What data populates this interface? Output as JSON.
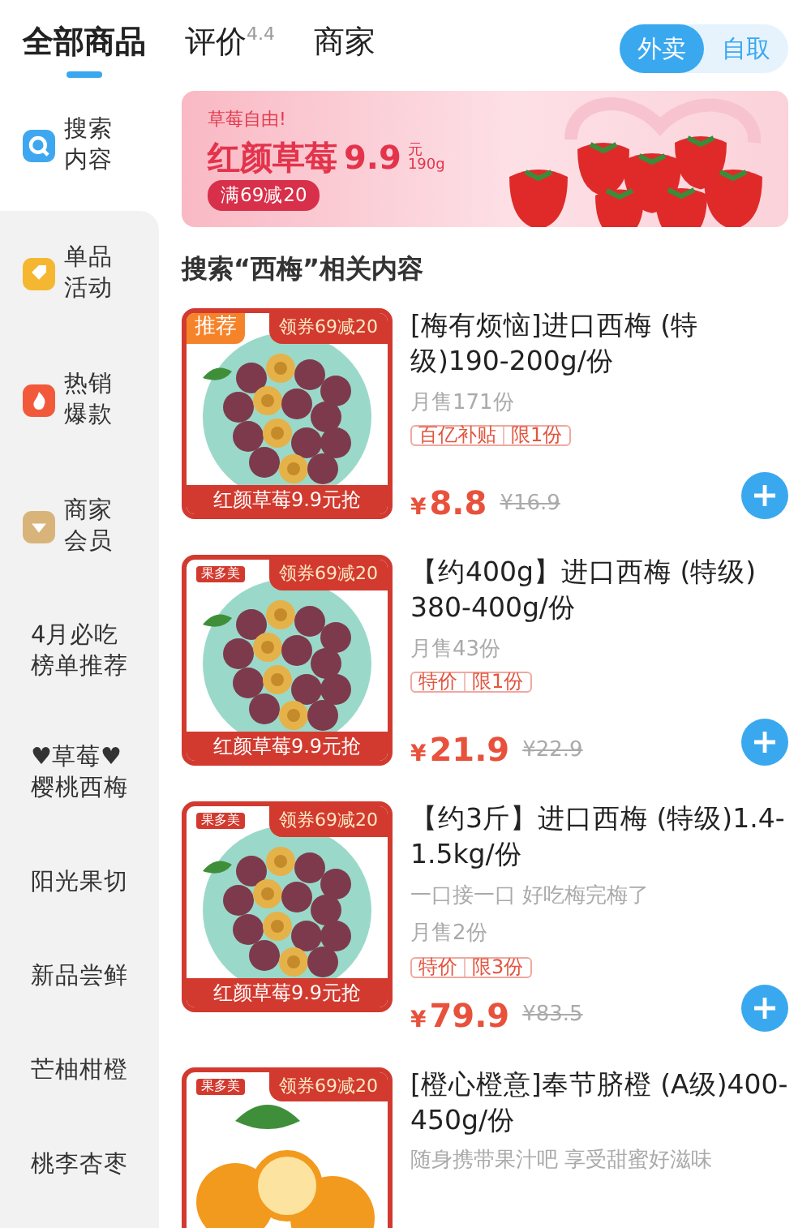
{
  "tabs": [
    {
      "label": "全部商品",
      "selected": true
    },
    {
      "label": "评价",
      "sup": "4.4",
      "selected": false
    },
    {
      "label": "商家",
      "selected": false
    }
  ],
  "mode_toggle": [
    {
      "label": "外卖",
      "selected": true
    },
    {
      "label": "自取",
      "selected": false
    }
  ],
  "banner": {
    "kicker": "草莓自由!",
    "headline": "红颜草莓",
    "price": "9.9",
    "unit_top": "元",
    "unit_bottom": "190g",
    "coupon": "满69减20"
  },
  "sidebar": {
    "items": [
      {
        "label": "搜索内容",
        "kind": "search",
        "color": "#3fa7f0",
        "selected": true
      },
      {
        "label": "单品活动",
        "kind": "tag",
        "color": "#f5b731",
        "selected": false
      },
      {
        "label": "热销爆款",
        "kind": "flame",
        "color": "#f2593b",
        "selected": false
      },
      {
        "label": "商家会员",
        "kind": "gem",
        "color": "#d9b47a",
        "selected": false
      },
      {
        "label": "4月必吃榜单推荐",
        "kind": "text",
        "selected": false
      },
      {
        "label": "♥草莓♥樱桃西梅",
        "kind": "text",
        "selected": false
      },
      {
        "label": "阳光果切",
        "kind": "text",
        "selected": false
      },
      {
        "label": "新品尝鲜",
        "kind": "text",
        "selected": false
      },
      {
        "label": "芒柚柑橙",
        "kind": "text",
        "selected": false
      },
      {
        "label": "桃李杏枣",
        "kind": "text",
        "selected": false
      }
    ]
  },
  "section_title": "搜索“西梅”相关内容",
  "products": [
    {
      "title": "[梅有烦恼]进口西梅 (特级)190-200g/份",
      "sales": "月售171份",
      "tags": [
        "百亿补贴",
        "限1份"
      ],
      "currency": "¥",
      "price": "8.8",
      "original_price": "¥16.9",
      "image": {
        "kind": "plum",
        "badge": {
          "text": "推荐",
          "kind": "recommend"
        },
        "coupon": "领券69减20",
        "strip": "红颜草莓9.9元抢"
      }
    },
    {
      "title": "【约400g】进口西梅 (特级) 380-400g/份",
      "sales": "月售43份",
      "tags": [
        "特价",
        "限1份"
      ],
      "currency": "¥",
      "price": "21.9",
      "original_price": "¥22.9",
      "image": {
        "kind": "plum",
        "badge": {
          "text": "果多美",
          "kind": "shop"
        },
        "coupon": "领券69减20",
        "strip": "红颜草莓9.9元抢"
      }
    },
    {
      "title": "【约3斤】进口西梅 (特级)1.4-1.5kg/份",
      "tagline": "一口接一口 好吃梅完梅了",
      "sales": "月售2份",
      "tags": [
        "特价",
        "限3份"
      ],
      "currency": "¥",
      "price": "79.9",
      "original_price": "¥83.5",
      "image": {
        "kind": "plum",
        "badge": {
          "text": "果多美",
          "kind": "shop"
        },
        "coupon": "领券69减20",
        "strip": "红颜草莓9.9元抢"
      }
    },
    {
      "title": "[橙心橙意]奉节脐橙 (A级)400-450g/份",
      "tagline": "随身携带果汁吧 享受甜蜜好滋味",
      "image": {
        "kind": "orange",
        "badge": {
          "text": "果多美",
          "kind": "shop"
        },
        "coupon": "领券69减20"
      }
    }
  ]
}
